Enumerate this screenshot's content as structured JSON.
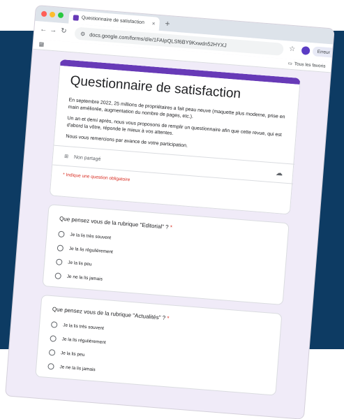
{
  "browser": {
    "tab_title": "Questionnaire de satisfaction",
    "tab_close": "×",
    "new_tab": "+",
    "url": "docs.google.com/forms/d/e/1FAIpQLSf6BY9Kxwdn52HYXJ",
    "error_label": "Erreur",
    "bookmarks_all": "Tous les favoris"
  },
  "form": {
    "title": "Questionnaire de satisfaction",
    "description": [
      "En septembre 2022, 25 millions de propriétaires a fait peau neuve (maquette plus moderne, prise en main améliorée, augmentation du nombre de pages, etc.).",
      "Un an et demi après, nous vous proposons de remplir un questionnaire afin que cette revue, qui est d'abord la vôtre, réponde le mieux à vos attentes.",
      "Nous vous remercions par avance de votre participation."
    ],
    "shared_label": "Non partagé",
    "required_note": "* Indique une question obligatoire"
  },
  "questions": [
    {
      "title": "Que pensez vous de la rubrique \"Editorial\" ?",
      "required_mark": "*",
      "options": [
        "Je la lis très souvent",
        "Je la lis régulièrement",
        "Je la lis peu",
        "Je ne la lis jamais"
      ]
    },
    {
      "title": "Que pensez vous de la rubrique \"Actualités\" ?",
      "required_mark": "*",
      "options": [
        "Je la lis très souvent",
        "Je la lis régulièrement",
        "Je la lis peu",
        "Je ne la lis jamais"
      ]
    }
  ],
  "colors": {
    "accent": "#673ab7",
    "background_navy": "#0d3b63",
    "form_background": "#f0ebf8",
    "required": "#d93025"
  },
  "icons": [
    "back-arrow-icon",
    "forward-arrow-icon",
    "reload-icon",
    "tune-icon",
    "star-icon",
    "apps-icon",
    "folder-icon",
    "cloud-icon",
    "radio-icon"
  ]
}
